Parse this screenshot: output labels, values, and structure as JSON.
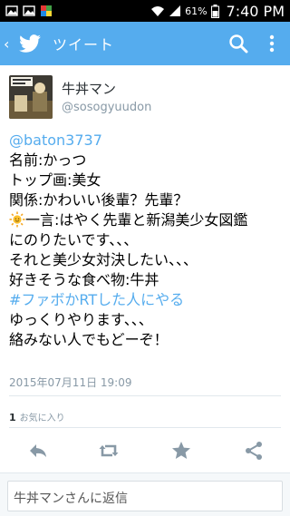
{
  "statusbar": {
    "battery": "61%",
    "time": "7:40 PM",
    "colors": {
      "bg": "#000000",
      "text": "#ffffff"
    },
    "icons": [
      "image-icon",
      "image-icon",
      "app-icon",
      "wifi-icon",
      "signal-icon",
      "battery-icon"
    ]
  },
  "actionbar": {
    "title": "ツイート",
    "color": "#55acee",
    "icons": [
      "back-arrow-icon",
      "twitter-bird-icon",
      "search-icon",
      "overflow-menu-icon"
    ]
  },
  "tweet": {
    "author_name": "牛丼マン",
    "author_handle": "@sosogyuudon",
    "lines": {
      "l1": "@baton3737",
      "l2": "名前:かっつ",
      "l3": "トップ画:美女",
      "l4": "関係:かわいい後輩？先輩？",
      "l5": "一言:はやく先輩と新潟美少女図鑑",
      "l6": "にのりたいです、、、",
      "l7": "それと美少女対決したい、、、",
      "l8": "好きそうな食べ物:牛丼",
      "l9": "#ファボかRTした人にやる",
      "l10": "ゆっくりやります、、、",
      "l11": "絡みない人でもどーぞ！"
    },
    "timestamp": "2015年07月11日 19:09",
    "fav_count": "1",
    "fav_label": "お気に入り",
    "link_color": "#55acee"
  },
  "actions": [
    "reply-icon",
    "retweet-icon",
    "favorite-star-icon",
    "share-icon"
  ],
  "reply": {
    "placeholder": "牛丼マンさんに返信"
  }
}
